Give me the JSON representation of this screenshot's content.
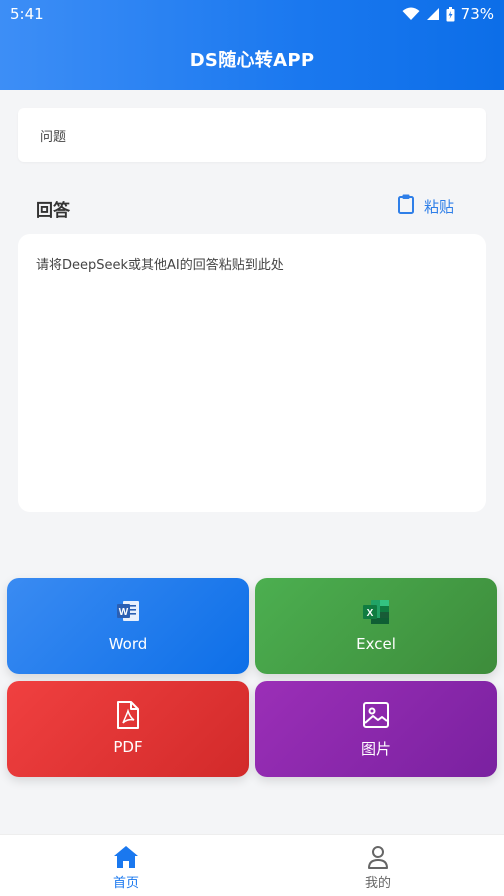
{
  "status_bar": {
    "time": "5:41",
    "battery": "73%"
  },
  "app_bar": {
    "title": "DS随心转APP"
  },
  "question": {
    "placeholder": "问题"
  },
  "answer": {
    "label": "回答",
    "paste_label": "粘贴",
    "placeholder": "请将DeepSeek或其他AI的回答粘贴到此处"
  },
  "export_buttons": [
    {
      "label": "Word",
      "icon": "word-icon",
      "color": "#1a78ef"
    },
    {
      "label": "Excel",
      "icon": "excel-icon",
      "color": "#43a047"
    },
    {
      "label": "PDF",
      "icon": "pdf-icon",
      "color": "#e53935"
    },
    {
      "label": "图片",
      "icon": "image-icon",
      "color": "#8e24aa"
    }
  ],
  "bottom_nav": {
    "items": [
      {
        "label": "首页",
        "icon": "home-icon",
        "active": true
      },
      {
        "label": "我的",
        "icon": "person-icon",
        "active": false
      }
    ]
  },
  "colors": {
    "primary": "#1a78ef",
    "background": "#f4f5f7"
  }
}
